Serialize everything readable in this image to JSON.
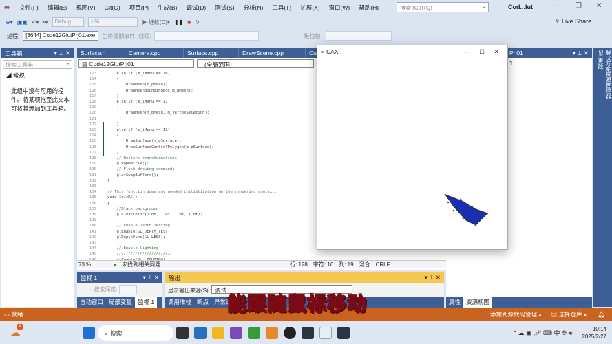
{
  "menubar": {
    "items": [
      "文件(F)",
      "编辑(E)",
      "视图(V)",
      "Git(G)",
      "项目(P)",
      "生成(B)",
      "调试(D)",
      "测试(S)",
      "分析(N)",
      "工具(T)",
      "扩展(X)",
      "窗口(W)",
      "帮助(H)"
    ],
    "search_placeholder": "搜索 (Ctrl+Q)",
    "title": "Cod...lut"
  },
  "toolbar": {
    "config": "Debug",
    "platform": "x86",
    "continue": "继续(C)",
    "live_share": "Live Share"
  },
  "procbar": {
    "label": "进程:",
    "process": "[8644] Code12GlutPrj01.exe",
    "lifecycle": "生命周期事件",
    "thread": "线程:",
    "stack": "堆栈帧:"
  },
  "toolbox": {
    "title": "工具箱",
    "search_placeholder": "搜索工具箱",
    "group": "常规",
    "message": "此组中没有可用的控件。将某项拖至此文本可将其添加到工具箱。"
  },
  "editor": {
    "tabs": [
      "Surface.h",
      "Camera.cpp",
      "Surface.cpp",
      "DrawScene.cpp",
      "Cu"
    ],
    "project": "Code12GlutPrj01",
    "scope": "(全局范围)",
    "lines": [
      {
        "n": "113",
        "t": "    else if (m_iMenu == 10)"
      },
      {
        "n": "114",
        "t": "    {"
      },
      {
        "n": "115",
        "t": "        DrawMesh(m_pMesh);"
      },
      {
        "n": "116",
        "t": "        DrawMeshBoundingBox(m_pMesh);"
      },
      {
        "n": "117",
        "t": "    }"
      },
      {
        "n": "118",
        "t": "    else if (m_iMenu == 11)"
      },
      {
        "n": "119",
        "t": "    {"
      },
      {
        "n": "120",
        "t": "        DrawMesh(m_pMesh, m_VertexSeletion);"
      },
      {
        "n": "121",
        "t": ""
      },
      {
        "n": "122",
        "t": "    }"
      },
      {
        "n": "123",
        "t": "    else if (m_iMenu == 12)"
      },
      {
        "n": "124",
        "t": "    {"
      },
      {
        "n": "125",
        "t": "        DrawSurface(m_pSurface);"
      },
      {
        "n": "126",
        "t": "        DrawSurfaceControlPolygon(m_pSurface);"
      },
      {
        "n": "127",
        "t": "    }"
      },
      {
        "n": "128",
        "t": "    // Restore transformations"
      },
      {
        "n": "129",
        "t": "    glPopMatrix();"
      },
      {
        "n": "130",
        "t": "    // Flush drawing commands"
      },
      {
        "n": "131",
        "t": "    glutSwapBuffers();"
      },
      {
        "n": "132",
        "t": "}"
      },
      {
        "n": "133",
        "t": ""
      },
      {
        "n": "134",
        "t": "// This function does any needed initialization on the rendering context."
      },
      {
        "n": "135",
        "t": "void InitRC()"
      },
      {
        "n": "136",
        "t": "{"
      },
      {
        "n": "137",
        "t": "    //Black background"
      },
      {
        "n": "138",
        "t": "    glClearColor(1.0f, 1.0f, 1.0f, 1.0f);"
      },
      {
        "n": "139",
        "t": ""
      },
      {
        "n": "140",
        "t": "    // Enable Depth Testing"
      },
      {
        "n": "141",
        "t": "    glEnable(GL_DEPTH_TEST);"
      },
      {
        "n": "142",
        "t": "    glDepthFunc(GL_LESS);"
      },
      {
        "n": "143",
        "t": ""
      },
      {
        "n": "144",
        "t": "    // Enable lighting"
      },
      {
        "n": "145",
        "t": "    ////////////////////////"
      },
      {
        "n": "146",
        "t": "    glEnable(GL_LIGHTING);"
      }
    ],
    "zoom": "73 %",
    "issues": "未找到相关问题",
    "row": "行: 128",
    "char": "字符: 16",
    "col": "列: 19",
    "mode": "混合",
    "eol": "CRLF"
  },
  "cax": {
    "title": "CAX",
    "shape_color": "#1a2fb0"
  },
  "solution": {
    "title": "Prj01",
    "item": "1",
    "vtabs": [
      "解决方案资源管理器",
      "Git 更改"
    ]
  },
  "watch": {
    "title": "监视 1",
    "depth_label": "搜索深度:",
    "tabs": [
      "自动窗口",
      "局部变量",
      "监视 1"
    ]
  },
  "output": {
    "title": "输出",
    "source_label": "显示输出来源(S):",
    "source": "调试",
    "tabs": [
      "调用堆栈",
      "断点",
      "异常设置"
    ]
  },
  "right_tabs": [
    "属性",
    "资源视图"
  ],
  "statusbar": {
    "ready": "就绪",
    "add_source": "添加到源代码管理",
    "select_repo": "选择仓库"
  },
  "taskbar": {
    "search": "搜索",
    "time": "10:14",
    "date": "2025/2/27",
    "ime": "中",
    "badge": "2"
  },
  "caption": "能跟随鼠标移动"
}
